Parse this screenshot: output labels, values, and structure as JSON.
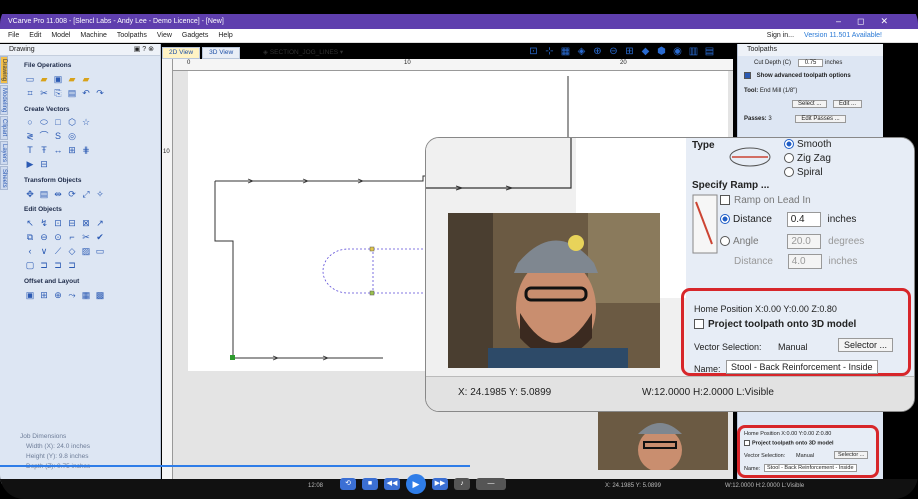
{
  "titlebar": {
    "title": "VCarve Pro 11.008 - [Slencl Labs - Andy Lee - Demo Licence] - [New]",
    "minimize": "–",
    "maximize": "◻",
    "close": "✕"
  },
  "menu": {
    "items": [
      "File",
      "Edit",
      "Model",
      "Machine",
      "Toolpaths",
      "View",
      "Gadgets",
      "Help"
    ],
    "signin": "Sign in...",
    "version": "Version 11.501 Available!"
  },
  "left": {
    "header": "Drawing",
    "tabs": [
      "Drawing",
      "Modeling",
      "Clipart",
      "Layers",
      "Sheets"
    ],
    "sections": {
      "file_ops": "File Operations",
      "create_vectors": "Create Vectors",
      "transform": "Transform Objects",
      "edit": "Edit Objects",
      "offset": "Offset and Layout"
    },
    "job": {
      "title": "Job Dimensions",
      "width": "Width  (X): 24.0 inches",
      "height": "Height (Y): 9.8 inches",
      "depth": "Depth  (Z): 0.75 inches"
    }
  },
  "view": {
    "tab_2d": "2D View",
    "tab_3d": "3D View",
    "layer": "SECTION_JOG_LINES",
    "ruler_top": [
      "0",
      "10",
      "20"
    ],
    "ruler_left": [
      "10"
    ]
  },
  "right": {
    "header": "Toolpaths",
    "cut_depth_label": "Cut Depth (C)",
    "cut_depth_value": "0.75",
    "cut_depth_unit": "inches",
    "advanced": "Show advanced toolpath options",
    "tool_label": "Tool:",
    "tool_value": "End Mill (1/8\")",
    "select": "Select ...",
    "edit": "Edit ...",
    "passes_label": "Passes:",
    "passes_value": "3",
    "edit_passes": "Edit Passes ..."
  },
  "zoom": {
    "type_label": "Type",
    "smooth": "Smooth",
    "zigzag": "Zig Zag",
    "spiral": "Spiral",
    "ramp_title": "Specify Ramp ...",
    "ramp_lead": "Ramp on Lead In",
    "distance_label": "Distance",
    "distance_value": "0.4",
    "distance_unit": "inches",
    "angle_label": "Angle",
    "angle_value": "20.0",
    "angle_unit": "degrees",
    "distance2_label": "Distance",
    "distance2_value": "4.0",
    "distance2_unit": "inches",
    "home_position": "Home Position   X:0.00 Y:0.00 Z:0.80",
    "project": "Project toolpath onto 3D model",
    "vector_sel_label": "Vector Selection:",
    "vector_sel_value": "Manual",
    "selector": "Selector ...",
    "name_label": "Name:",
    "name_value": "Stool - Back Reinforcement - Inside",
    "status_xy": "X: 24.1985 Y: 5.0899",
    "status_wh": "W:12.0000  H:2.0000  L:Visible"
  },
  "small": {
    "home": "Home Position  X:0.00 Y:0.00 Z:0.80",
    "project": "Project toolpath onto 3D model",
    "vector": "Vector Selection:",
    "manual": "Manual",
    "selector": "Selector ...",
    "name": "Name:",
    "name_value": "Stool - Back Reinforcement - Inside"
  },
  "status": {
    "time": "12:08",
    "xy": "X: 24.1985 Y: 5.0899",
    "wh": "W:12.0000  H:2.0000  L:Visible"
  },
  "colors": {
    "accent": "#2f7de8",
    "highlight": "#d7262a",
    "title": "#5f3fae"
  }
}
